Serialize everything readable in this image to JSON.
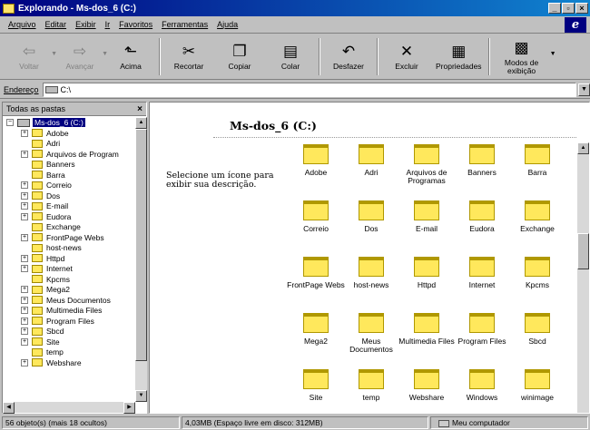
{
  "window": {
    "title": "Explorando - Ms-dos_6 (C:)",
    "buttons": [
      "_",
      "▫",
      "×"
    ]
  },
  "menu": [
    "Arquivo",
    "Editar",
    "Exibir",
    "Ir",
    "Favoritos",
    "Ferramentas",
    "Ajuda"
  ],
  "toolbar": {
    "back": "Voltar",
    "forward": "Avançar",
    "up": "Acima",
    "cut": "Recortar",
    "copy": "Copiar",
    "paste": "Colar",
    "undo": "Desfazer",
    "delete": "Excluir",
    "properties": "Propriedades",
    "views": "Modos de exibição"
  },
  "address": {
    "label": "Endereço",
    "value": "C:\\"
  },
  "folders_pane": {
    "header": "Todas as pastas",
    "close": "×",
    "root": "Ms-dos_6 (C:)",
    "items": [
      {
        "label": "Adobe",
        "exp": true
      },
      {
        "label": "Adri",
        "exp": false
      },
      {
        "label": "Arquivos de Program",
        "exp": true
      },
      {
        "label": "Banners",
        "exp": false
      },
      {
        "label": "Barra",
        "exp": false
      },
      {
        "label": "Correio",
        "exp": true
      },
      {
        "label": "Dos",
        "exp": true
      },
      {
        "label": "E-mail",
        "exp": true
      },
      {
        "label": "Eudora",
        "exp": true
      },
      {
        "label": "Exchange",
        "exp": false
      },
      {
        "label": "FrontPage Webs",
        "exp": true
      },
      {
        "label": "host-news",
        "exp": false
      },
      {
        "label": "Httpd",
        "exp": true
      },
      {
        "label": "Internet",
        "exp": true
      },
      {
        "label": "Kpcms",
        "exp": false
      },
      {
        "label": "Mega2",
        "exp": true
      },
      {
        "label": "Meus Documentos",
        "exp": true
      },
      {
        "label": "Multimedia Files",
        "exp": true
      },
      {
        "label": "Program Files",
        "exp": true
      },
      {
        "label": "Sbcd",
        "exp": true
      },
      {
        "label": "Site",
        "exp": true
      },
      {
        "label": "temp",
        "exp": false
      },
      {
        "label": "Webshare",
        "exp": true
      }
    ]
  },
  "content": {
    "title": "Ms-dos_6 (C:)",
    "description": "Selecione um ícone para exibir sua descrição.",
    "icons": [
      "Adobe",
      "Adri",
      "Arquivos de Programas",
      "Banners",
      "Barra",
      "Correio",
      "Dos",
      "E-mail",
      "Eudora",
      "Exchange",
      "FrontPage Webs",
      "host-news",
      "Httpd",
      "Internet",
      "Kpcms",
      "Mega2",
      "Meus Documentos",
      "Multimedia Files",
      "Program Files",
      "Sbcd",
      "Site",
      "temp",
      "Webshare",
      "Windows",
      "winimage"
    ]
  },
  "status": {
    "objects": "56 objeto(s) (mais 18 ocultos)",
    "disk": "4,03MB (Espaço livre em disco: 312MB)",
    "zone": "Meu computador"
  }
}
